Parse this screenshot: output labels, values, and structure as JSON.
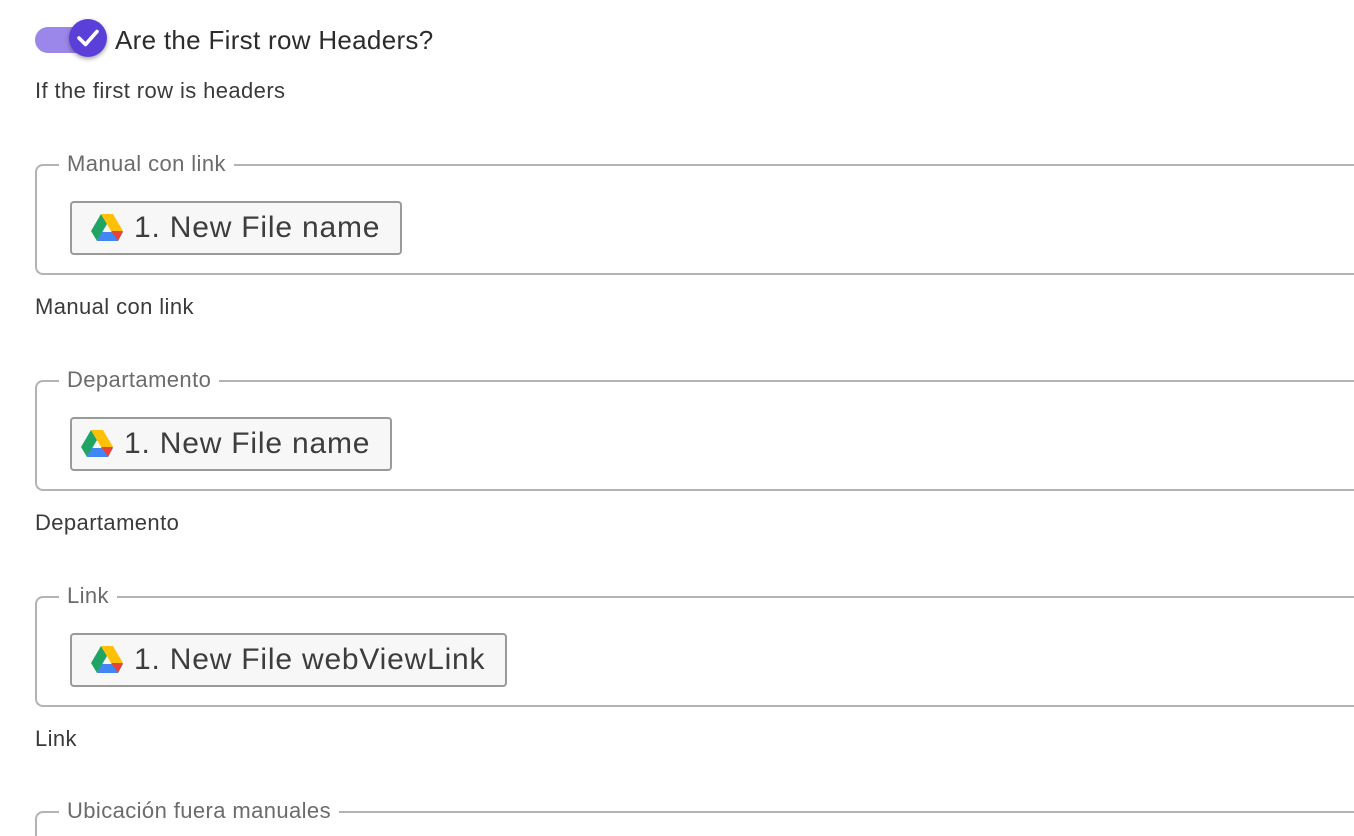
{
  "toggle": {
    "label": "Are the First row Headers?",
    "checked": true,
    "track_color": "#9b86ea",
    "knob_color": "#5b3fd9",
    "icon": "check-icon"
  },
  "toggle_help": "If the first row is headers",
  "fields": [
    {
      "legend": "Manual con link",
      "chip_text": "1. New File name",
      "chip_icon": "google-drive-icon",
      "help": "Manual con link"
    },
    {
      "legend": "Departamento",
      "chip_text": "1. New File name",
      "chip_icon": "google-drive-icon",
      "help": "Departamento"
    },
    {
      "legend": "Link",
      "chip_text": "1. New File webViewLink",
      "chip_icon": "google-drive-icon",
      "help": "Link"
    }
  ],
  "partial_field": {
    "legend": "Ubicación fuera manuales"
  }
}
